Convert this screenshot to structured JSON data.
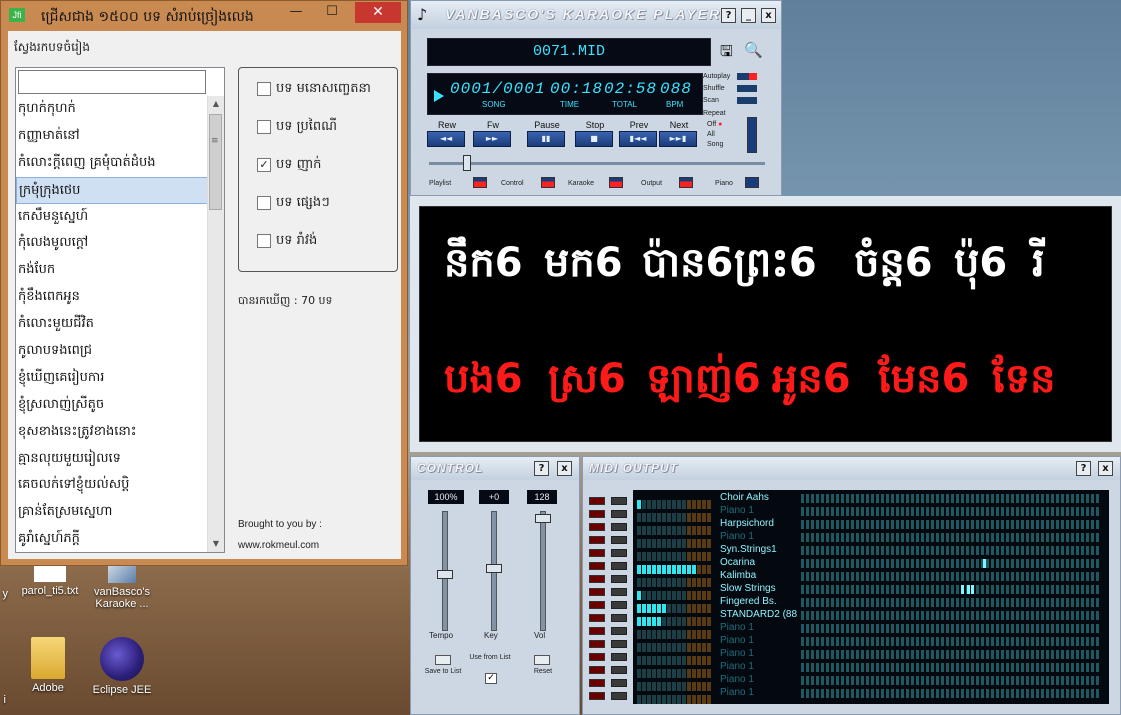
{
  "desktop": {
    "icons": [
      {
        "label": "parol_ti5.txt"
      },
      {
        "label": "vanBasco's Karaoke ..."
      },
      {
        "label": "Adobe"
      },
      {
        "label": "Eclipse JEE"
      },
      {
        "label_left1": "y",
        "label_left2": "i"
      }
    ]
  },
  "songwin": {
    "title": "ជ្រើសជាង ១៥០០ បទ សំរាប់ច្រៀងលេង",
    "title_logo": "Jfi",
    "minimize": "—",
    "maximize": "☐",
    "close": "✕",
    "search_label": "ស្វែងរកបទចំរៀង",
    "search_value": "",
    "songs": [
      "កុហក់កុហក់",
      "កញ្ញាមាត់នៅ",
      "កំលោះក្តីពេញ គ្រមុំបាត់ដំបង",
      "ក្រមុំក្រុងថេប",
      "កេសឹមនួស្នេហ៍",
      "កុំលេងមូលក្តៅ",
      "កង់បែក",
      "កុំខឹងពេកអូន",
      "កំលោះមួយជីវិត",
      "កូលាបទងពេជ្រ",
      "ខ្ញុំឃើញគេរៀបការ",
      "ខ្ញុំស្រលាញ់ស្រីតូច",
      "ខុសខាងនេះត្រូវខាងនោះ",
      "គ្មានលុយមួយរៀលទេ",
      "គេចលក់ទៅខ្ញុំយល់សប្តិ",
      "គ្រាន់តែស្រមស្នេហា",
      "គូរាំស្នេហ៍ភក្តី"
    ],
    "selected_index": 3,
    "categories": [
      {
        "label": "បទ មនោសញ្ចេតនា",
        "checked": false
      },
      {
        "label": "បទ ប្រពៃណី",
        "checked": false
      },
      {
        "label": "បទ ញាក់",
        "checked": true
      },
      {
        "label": "បទ ផ្សេងៗ",
        "checked": false
      },
      {
        "label": "បទ រាំវង់",
        "checked": false
      }
    ],
    "found_text": "បានរកឃើញ :   70 បទ",
    "brought_text": "Brought to you by :",
    "url_text": "www.rokmeul.com"
  },
  "player": {
    "title": "VANBASCO'S KARAOKE PLAYER",
    "help": "?",
    "minimize": "_",
    "close": "x",
    "filename": "0071.MID",
    "song_value": "0001/0001",
    "time_value": "00:18",
    "total_value": "02:58",
    "bpm_value": "088",
    "labels": {
      "song": "SONG",
      "time": "TIME",
      "total": "TOTAL",
      "bpm": "BPM"
    },
    "modes": {
      "autoplay": "Autoplay",
      "shuffle": "Shuffle",
      "scan": "Scan",
      "repeat": "Repeat",
      "off": "Off",
      "all": "All",
      "song": "Song"
    },
    "transport": [
      "Rew",
      "Fw",
      "Pause",
      "Stop",
      "Prev",
      "Next"
    ],
    "transport_icons": [
      "◄◄",
      "►►",
      "▮▮",
      "■",
      "▮◄◄",
      "►►▮"
    ],
    "bottom": [
      "Playlist",
      "Control",
      "Karaoke",
      "Output",
      "Piano"
    ],
    "position_fraction": 0.1
  },
  "lyrics": {
    "line1": [
      "នឹក6",
      "មក6",
      "ប៉ាន6",
      "ព្រះ6",
      "ចំន្ត6",
      "ប៉ុ6",
      "រី"
    ],
    "line2": [
      "បង6",
      "ស្រ6",
      "ឡាញ់6",
      "អូន6",
      "មែន6",
      "ទែន"
    ],
    "color_sung": "#ffffff",
    "color_next": "#ff1a1a"
  },
  "control": {
    "title": "CONTROL",
    "help": "?",
    "close": "x",
    "tempo_value": "100%",
    "key_value": "+0",
    "vol_value": "128",
    "tempo_label": "Tempo",
    "key_label": "Key",
    "vol_label": "Vol",
    "save_label": "Save to List",
    "use_label": "Use from List",
    "use_checked": "✓",
    "reset_label": "Reset"
  },
  "midi": {
    "title": "MIDI OUTPUT",
    "help": "?",
    "close": "x",
    "channels": [
      {
        "name": "Choir Aahs",
        "active": true,
        "level": 1
      },
      {
        "name": "Piano 1",
        "active": false,
        "level": 0
      },
      {
        "name": "Harpsichord",
        "active": true,
        "level": 0
      },
      {
        "name": "Piano 1",
        "active": false,
        "level": 0
      },
      {
        "name": "Syn.Strings1",
        "active": true,
        "level": 0
      },
      {
        "name": "Ocarina",
        "active": true,
        "level": 12
      },
      {
        "name": "Kalimba",
        "active": true,
        "level": 0
      },
      {
        "name": "Slow Strings",
        "active": true,
        "level": 1
      },
      {
        "name": "Fingered Bs.",
        "active": true,
        "level": 6
      },
      {
        "name": "STANDARD2 (88",
        "active": true,
        "level": 5
      },
      {
        "name": "Piano 1",
        "active": false,
        "level": 0
      },
      {
        "name": "Piano 1",
        "active": false,
        "level": 0
      },
      {
        "name": "Piano 1",
        "active": false,
        "level": 0
      },
      {
        "name": "Piano 1",
        "active": false,
        "level": 0
      },
      {
        "name": "Piano 1",
        "active": false,
        "level": 0
      },
      {
        "name": "Piano 1",
        "active": false,
        "level": 0
      }
    ]
  }
}
